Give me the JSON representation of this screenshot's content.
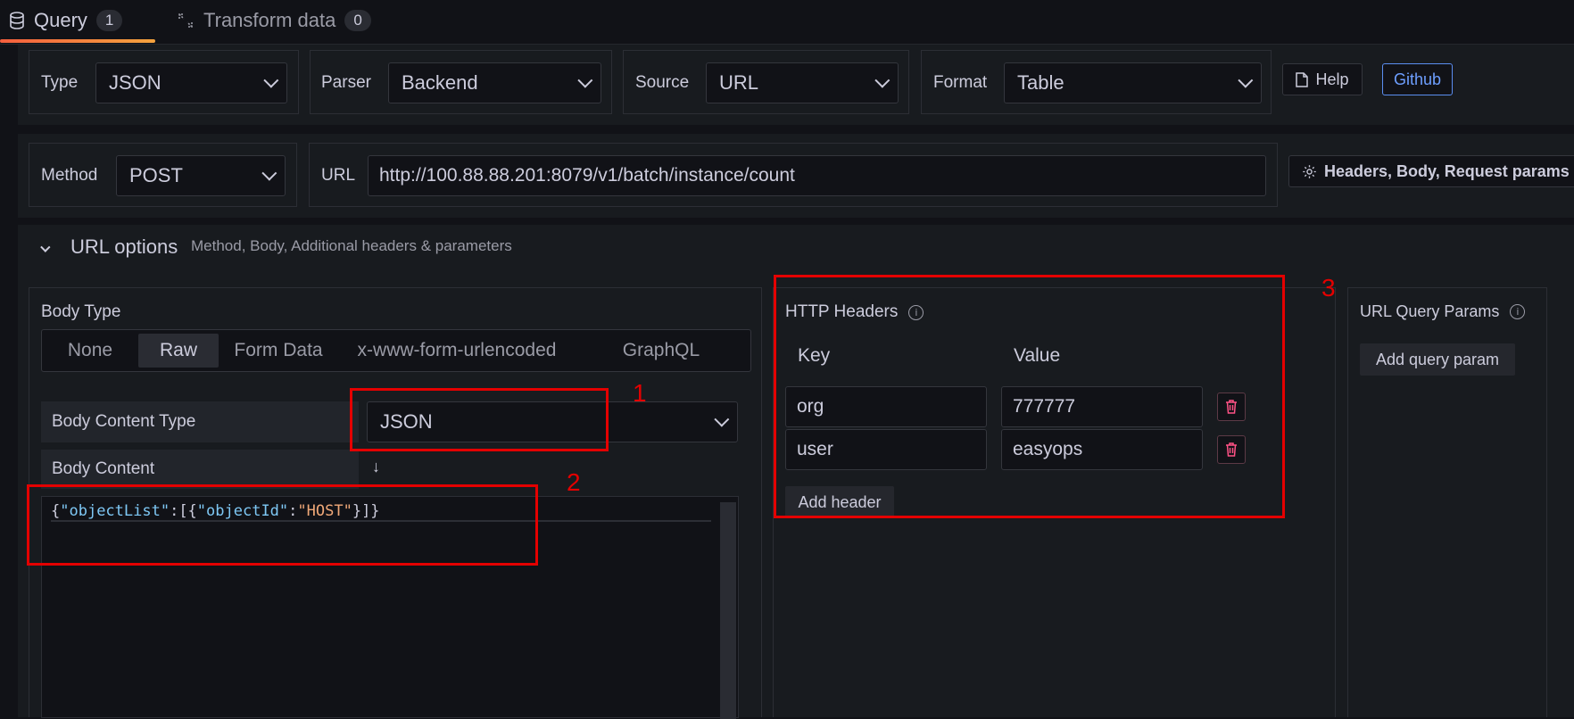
{
  "tabs": [
    {
      "label": "Query",
      "count": "1"
    },
    {
      "label": "Transform data",
      "count": "0"
    }
  ],
  "toolbar": {
    "type_label": "Type",
    "type_value": "JSON",
    "parser_label": "Parser",
    "parser_value": "Backend",
    "source_label": "Source",
    "source_value": "URL",
    "format_label": "Format",
    "format_value": "Table",
    "help_label": "Help",
    "github_label": "Github"
  },
  "request": {
    "method_label": "Method",
    "method_value": "POST",
    "url_label": "URL",
    "url_value": "http://100.88.88.201:8079/v1/batch/instance/count",
    "headers_button": "Headers, Body, Request params"
  },
  "url_options": {
    "title": "URL options",
    "subtitle": "Method, Body, Additional headers & parameters"
  },
  "body": {
    "type_label": "Body Type",
    "types": [
      "None",
      "Raw",
      "Form Data",
      "x-www-form-urlencoded",
      "GraphQL"
    ],
    "selected_type": "Raw",
    "content_type_label": "Body Content Type",
    "content_type_value": "JSON",
    "content_label": "Body Content",
    "code": {
      "p1": "{",
      "k1": "\"objectList\"",
      "p2": ":[{",
      "k2": "\"objectId\"",
      "p3": ":",
      "v1": "\"HOST\"",
      "p4": "}]}"
    }
  },
  "headers": {
    "title": "HTTP Headers",
    "key_col": "Key",
    "value_col": "Value",
    "rows": [
      {
        "key": "org",
        "value": "777777"
      },
      {
        "key": "user",
        "value": "easyops"
      }
    ],
    "add_label": "Add header"
  },
  "query_params": {
    "title": "URL Query Params",
    "add_label": "Add query param"
  },
  "annotations": [
    "1",
    "2",
    "3"
  ],
  "colors": {
    "background": "#111217",
    "panel": "#181b1f",
    "accent_link": "#6e9fff",
    "annotation_red": "#e40000",
    "danger": "#ff5286",
    "json_key": "#7ec8f5",
    "json_string": "#f0a878"
  }
}
